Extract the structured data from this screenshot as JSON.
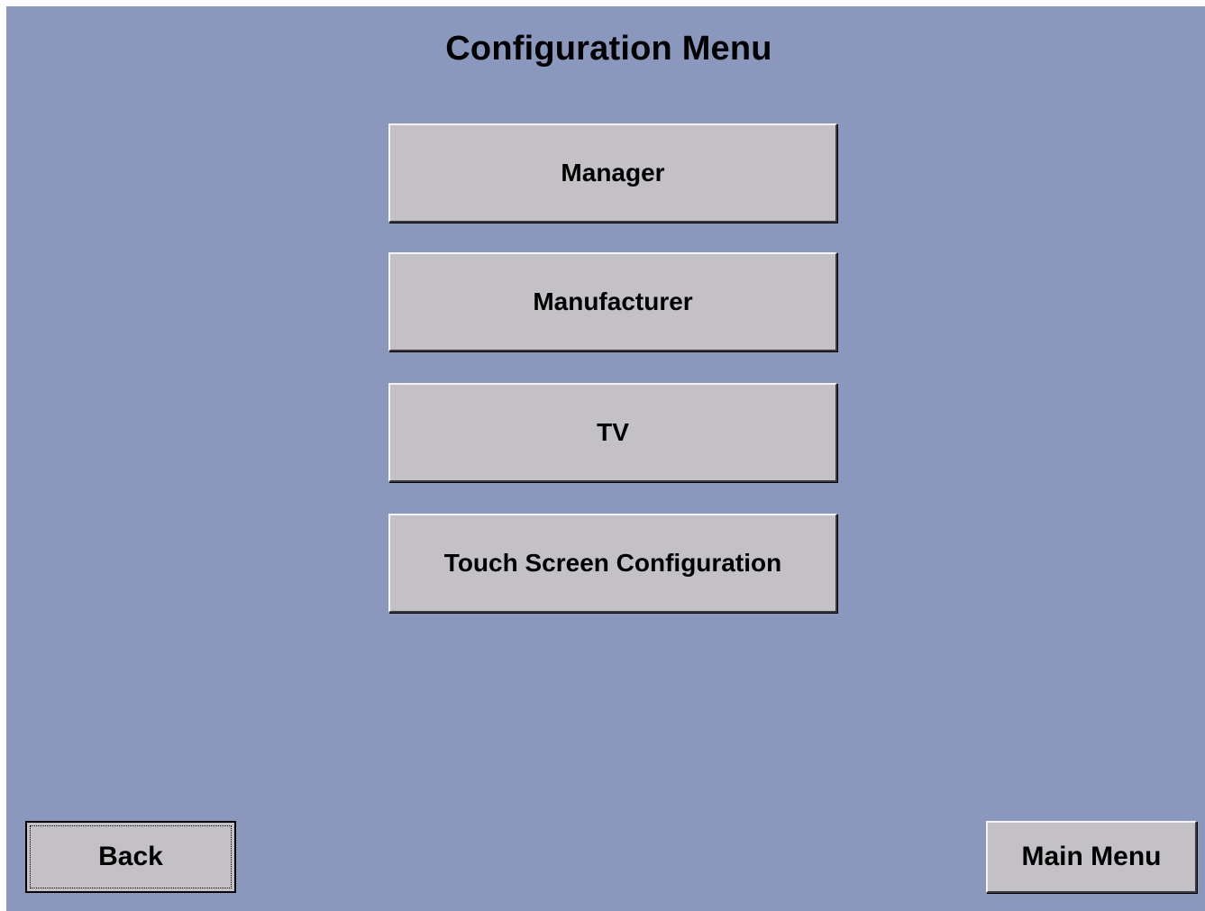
{
  "title": "Configuration Menu",
  "menu": {
    "items": [
      {
        "label": "Manager"
      },
      {
        "label": "Manufacturer"
      },
      {
        "label": "TV"
      },
      {
        "label": "Touch Screen Configuration"
      }
    ]
  },
  "nav": {
    "back_label": "Back",
    "main_menu_label": "Main Menu"
  },
  "colors": {
    "background": "#8a98bd",
    "button_face": "#c3c1c6",
    "text": "#000000"
  }
}
